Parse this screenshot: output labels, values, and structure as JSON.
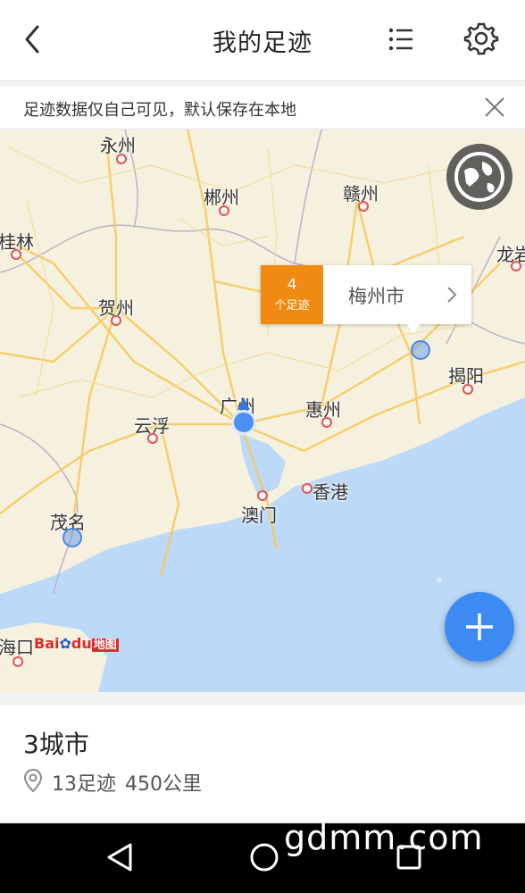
{
  "header": {
    "title": "我的足迹"
  },
  "notice": {
    "text": "足迹数据仅自己可见，默认保存在本地"
  },
  "map": {
    "cities": [
      {
        "name": "永州",
        "key": "yongzhou"
      },
      {
        "name": "郴州",
        "key": "chenzhou"
      },
      {
        "name": "赣州",
        "key": "ganzhou"
      },
      {
        "name": "桂林",
        "key": "guilin"
      },
      {
        "name": "龙岩",
        "key": "longyan"
      },
      {
        "name": "贺州",
        "key": "hezhou"
      },
      {
        "name": "揭阳",
        "key": "jieyang"
      },
      {
        "name": "广州",
        "key": "guangzhou"
      },
      {
        "name": "惠州",
        "key": "huizhou"
      },
      {
        "name": "云浮",
        "key": "yunfu"
      },
      {
        "name": "香港",
        "key": "hongkong"
      },
      {
        "name": "澳门",
        "key": "macau"
      },
      {
        "name": "茂名",
        "key": "maoming"
      },
      {
        "name": "海口",
        "key": "haikou"
      }
    ],
    "popup": {
      "count": "4",
      "count_label": "个足迹",
      "city": "梅州市"
    },
    "logo_text": {
      "bai": "Bai",
      "du": "du",
      "map_word": "地图"
    },
    "colors": {
      "water": "#bcd9f7",
      "land": "#f6f1df",
      "road": "#f7c95a",
      "marker": "#4a86e8",
      "accent": "#f08a12"
    }
  },
  "stats": {
    "cities": "3城市",
    "footprints": "13足迹",
    "distance": "450公里"
  },
  "watermark": "gdmm.com"
}
